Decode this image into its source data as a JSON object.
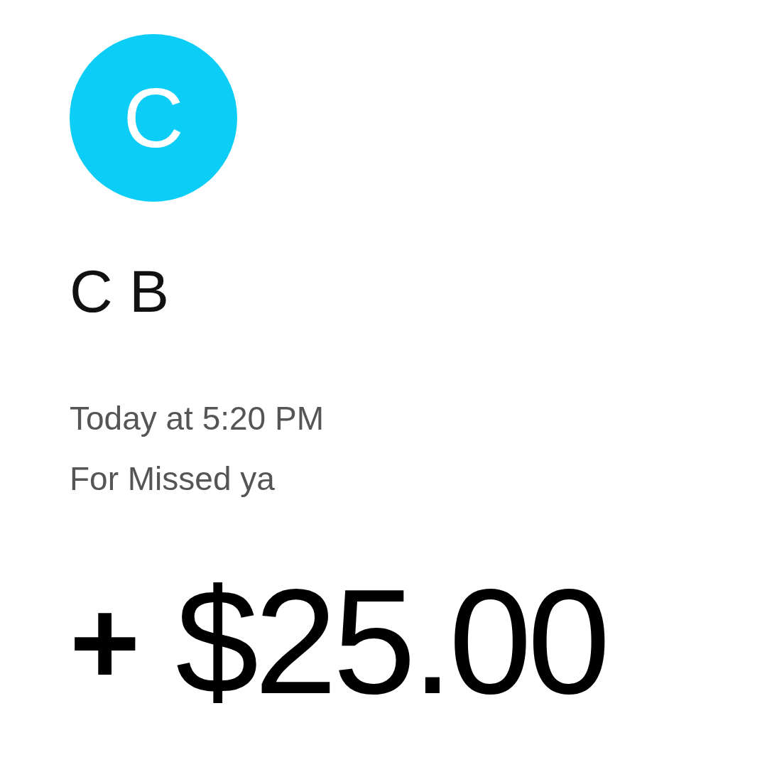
{
  "avatar": {
    "initial": "C",
    "color": "#0ccdf5"
  },
  "name": "C B",
  "time": "Today at 5:20 PM",
  "note": "For Missed ya",
  "amount": {
    "sign": "+",
    "value": "$25.00"
  }
}
